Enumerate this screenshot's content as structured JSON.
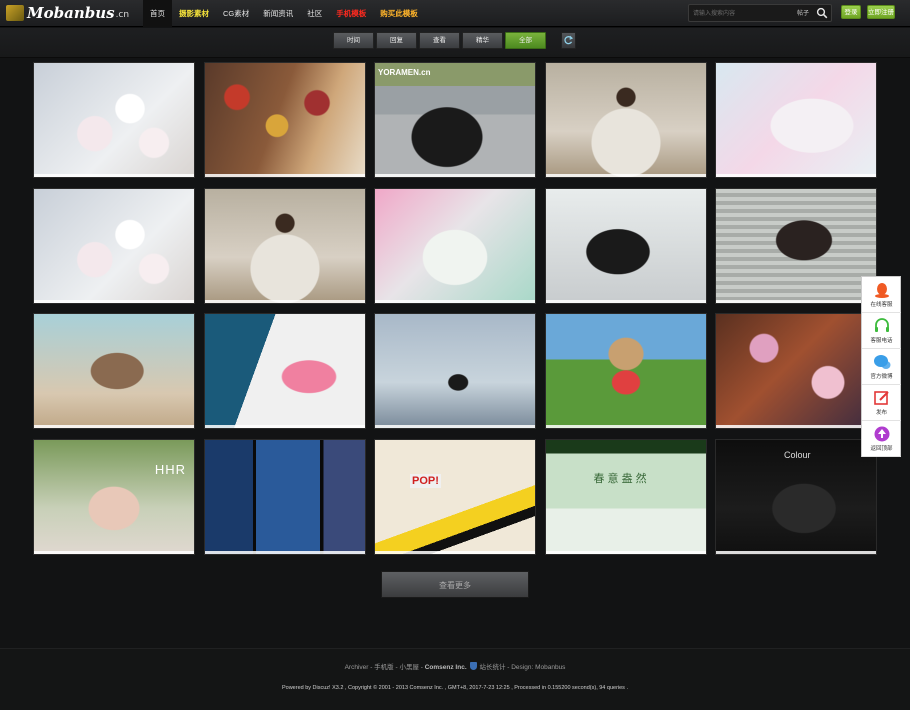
{
  "header": {
    "logo_text": "Mobanbus",
    "logo_suffix": ".cn",
    "nav": [
      {
        "label": "首页",
        "style": "active"
      },
      {
        "label": "摄影素材",
        "style": "yellow"
      },
      {
        "label": "CG素材",
        "style": "normal"
      },
      {
        "label": "新闻资讯",
        "style": "normal"
      },
      {
        "label": "社区",
        "style": "normal"
      },
      {
        "label": "手机模板",
        "style": "red"
      },
      {
        "label": "购买此模板",
        "style": "orange"
      }
    ],
    "search_placeholder": "请输入搜索内容",
    "search_scope": "帖子",
    "login_label": "登录",
    "register_label": "立即注册"
  },
  "filters": [
    {
      "label": "时间",
      "active": false
    },
    {
      "label": "回复",
      "active": false
    },
    {
      "label": "查看",
      "active": false
    },
    {
      "label": "精华",
      "active": false
    },
    {
      "label": "全部",
      "active": true
    }
  ],
  "tiles": [
    {
      "subject": "cherry-blossom"
    },
    {
      "subject": "love-locks"
    },
    {
      "subject": "supercar",
      "overlay_text": "YORAMEN.cn"
    },
    {
      "subject": "woman-with-lights"
    },
    {
      "subject": "woman-pastel-sofa"
    },
    {
      "subject": "cherry-blossom"
    },
    {
      "subject": "woman-with-lights"
    },
    {
      "subject": "woman-pastel-dress"
    },
    {
      "subject": "man-in-jacket"
    },
    {
      "subject": "woman-dark-hair"
    },
    {
      "subject": "girl-beach"
    },
    {
      "subject": "woman-floral-dress"
    },
    {
      "subject": "man-in-water"
    },
    {
      "subject": "girl-watermelon"
    },
    {
      "subject": "woman-flowers"
    },
    {
      "subject": "woman-garden",
      "overlay_text": "HHR"
    },
    {
      "subject": "spiderman-posters"
    },
    {
      "subject": "pop-art-girl",
      "overlay_text": "POP!"
    },
    {
      "subject": "green-photo-poster",
      "overlay_text": "春 意 盎 然"
    },
    {
      "subject": "phones-colour",
      "overlay_text": "Colour"
    }
  ],
  "load_more_label": "查看更多",
  "sidebar": [
    {
      "label": "在线客服",
      "icon": "qq-penguin-icon",
      "color": "#f05a24"
    },
    {
      "label": "客服电话",
      "icon": "headset-icon",
      "color": "#3dbb3d"
    },
    {
      "label": "官方微博",
      "icon": "chat-bubble-icon",
      "color": "#3a9ee8"
    },
    {
      "label": "发布",
      "icon": "edit-icon",
      "color": "#e33838"
    },
    {
      "label": "返回顶部",
      "icon": "arrow-up-circle-icon",
      "color": "#b03ccf"
    }
  ],
  "footer": {
    "links_prefix": "Archiver - 手机版 - 小黑屋 - ",
    "company": "Comsenz Inc.",
    "links_suffix": "站长统计 - Design: Mobanbus",
    "copyright": "Powered by Discuz! X3.2 , Copyright © 2001 - 2013 Comsenz Inc. , GMT+8, 2017-7-23 12:25 , Processed in 0.155200 second(s), 94 queries ."
  }
}
